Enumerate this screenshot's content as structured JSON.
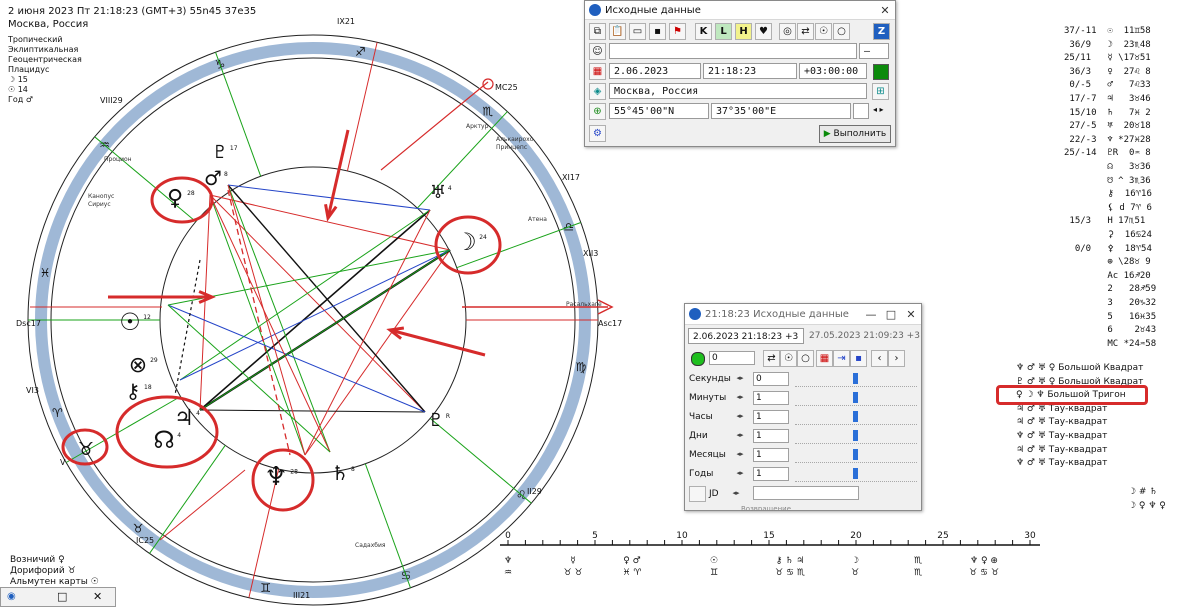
{
  "header": {
    "datetime": "2 июня 2023  Пт  21:18:23 (GMT+3) 55n45  37e35",
    "place": "Москва, Россия",
    "settings": [
      "Тропический",
      "Эклиптикальная",
      "Геоцентрическая",
      "Плацидус"
    ],
    "moon_line": "☽ 15",
    "sun_line": "☉ 14",
    "year_lord": "Год ♂"
  },
  "chart": {
    "cusp_labels": [
      "Dsc17",
      "Asc17",
      "MC25",
      "IC25",
      "IX21",
      "VIII29",
      "VI3",
      "V",
      "XI17",
      "XII3",
      "II29",
      "III21"
    ],
    "stars": [
      "Процион",
      "Канопус",
      "Сириус",
      "Арктур",
      "Алькаирохо",
      "Принцепс",
      "Атена",
      "Садахбия",
      "Расальхаге"
    ],
    "planet_degrees": {
      "venus": "28",
      "mars": "8",
      "pluto_top": "17",
      "uranus": "4",
      "moon": "24",
      "sun": "12",
      "node": "4",
      "jupiter": "4",
      "saturn": "8",
      "neptune": "28",
      "chiron": "18",
      "pluto": "R"
    },
    "bottom_zodiac": "♈"
  },
  "dialog1": {
    "title": "Исходные данные",
    "name_value": "",
    "name_dropdown": "—",
    "date": "2.06.2023",
    "time": "21:18:23",
    "tz": "+03:00:00",
    "place": "Москва, Россия",
    "lat": "55°45'00\"N",
    "lon": "37°35'00\"E",
    "run_label": "Выполнить",
    "toolbar_icons": [
      "K",
      "L",
      "H"
    ]
  },
  "dialog2": {
    "title": "21:18:23  Исходные данные",
    "current": "2.06.2023  21:18:23  +3",
    "previous": "27.05.2023  21:09:23  +3",
    "step_value": "0",
    "rows": [
      {
        "label": "Секунды",
        "value": "0"
      },
      {
        "label": "Минуты",
        "value": "1"
      },
      {
        "label": "Часы",
        "value": "1"
      },
      {
        "label": "Дни",
        "value": "1"
      },
      {
        "label": "Месяцы",
        "value": "1"
      },
      {
        "label": "Годы",
        "value": "1"
      }
    ],
    "jd_label": "JD",
    "footer": "Возвращение"
  },
  "right_panel": {
    "rows": [
      "37/-11  ☉  11♊58",
      " 36/9   ☽  23♏48",
      "25/11   ☿ \\17♉51",
      " 36/3   ♀  27♌ 8",
      " 0/-5   ♂   7♌33",
      " 17/-7  ♃   3♉46",
      " 15/10  ♄   7♓ 2",
      " 27/-5  ♅  20♉18",
      " 22/-3  ♆ *27♓28",
      "25/-14  ♇R  0♒ 8",
      "        ☊   3♉36",
      "        ☋ ^ 3♏36",
      "        ⚷  16♈16",
      "        ⚸ d 7♈ 6",
      " 15/3   H 17♏51",
      "        ⚳  16♋24",
      "  0/0   ⚴  18♈54",
      "        ⊕ \\28♉ 9",
      "        Ac 16♐20",
      "        2   28♐59",
      "        3   20♑32",
      "        5   16♓35",
      "        6    2♉43",
      "        MC *24♒58"
    ],
    "aspects": [
      {
        "glyphs": "♆ ♂ ♅ ♀",
        "name": "Большой Квадрат"
      },
      {
        "glyphs": "♇ ♂ ♅ ♀",
        "name": "Большой Квадрат"
      },
      {
        "glyphs": "♀ ☽ ♆",
        "name": "Большой Тригон"
      },
      {
        "glyphs": "♃ ♂ ♅",
        "name": "Тау-квадрат"
      },
      {
        "glyphs": "♃ ♂ ♅",
        "name": "Тау-квадрат"
      },
      {
        "glyphs": "♆ ♂ ♅",
        "name": "Тау-квадрат"
      },
      {
        "glyphs": "♃ ♂ ♅",
        "name": "Тау-квадрат"
      },
      {
        "glyphs": "♆ ♂ ♅",
        "name": "Тау-квадрат"
      }
    ],
    "extra_right1": "☽ # ♄",
    "extra_right2": "☽ ♀ ♆ ♀"
  },
  "bottom_left": {
    "ruler": "Возничий ♀",
    "doryphory": "Дорифорий ♉",
    "almuten": "Альмутен карты ☉"
  },
  "timeline": {
    "ticks": [
      "0",
      "5",
      "10",
      "15",
      "20",
      "25",
      "30"
    ]
  },
  "colors": {
    "red": "#d62b2b",
    "green": "#1aa31a",
    "blue": "#2545c8",
    "wheel": "#9fb8d6",
    "accent": "#1f5fbf"
  }
}
